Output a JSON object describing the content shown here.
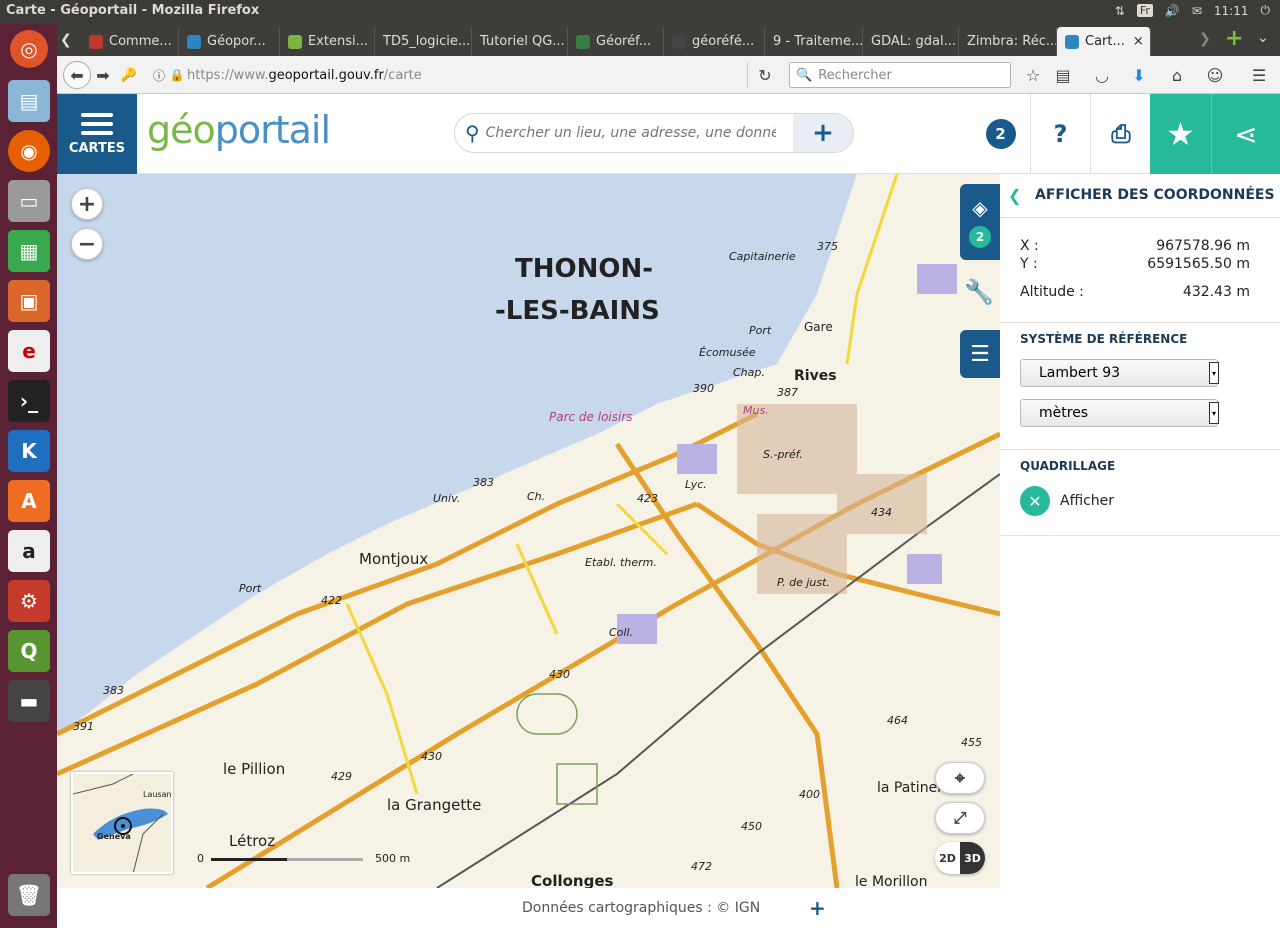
{
  "window": {
    "title": "Carte - Géoportail - Mozilla Firefox",
    "lang": "Fr",
    "time": "11:11"
  },
  "tabs": [
    {
      "label": "Comme...",
      "color": "#c0392b"
    },
    {
      "label": "Géopor...",
      "color": "#2e86c1"
    },
    {
      "label": "Extensi...",
      "color": "#7cb342"
    },
    {
      "label": "TD5_logicie...",
      "color": ""
    },
    {
      "label": "Tutoriel QG...",
      "color": ""
    },
    {
      "label": "Géoréf...",
      "color": "#3a7d44"
    },
    {
      "label": "géoréfé...",
      "color": "#444"
    },
    {
      "label": "9 - Traiteme...",
      "color": ""
    },
    {
      "label": "GDAL: gdal...",
      "color": ""
    },
    {
      "label": "Zimbra: Réc...",
      "color": ""
    },
    {
      "label": "Cart...",
      "color": "#2e86c1"
    }
  ],
  "url": {
    "prefix": "https://www.",
    "domain": "geoportail.gouv.fr",
    "path": "/carte"
  },
  "browser_search": {
    "placeholder": "Rechercher"
  },
  "header": {
    "cartes_label": "CARTES",
    "logo_geo": "géo",
    "logo_portail": "portail",
    "search_placeholder": "Chercher un lieu, une adresse, une donnée",
    "layers_count": "2",
    "help": "?"
  },
  "map": {
    "labels": {
      "city_line1": "THONON-",
      "city_line2": "-LES-BAINS",
      "capitainerie": "Capitainerie",
      "port": "Port",
      "ecomusee": "Écomusée",
      "chap": "Chap.",
      "rives": "Rives",
      "gare": "Gare",
      "parc": "Parc de loisirs",
      "univ": "Univ.",
      "ch": "Ch.",
      "lyc": "Lyc.",
      "spref": "S.-préf.",
      "mus": "Mus.",
      "montjoux": "Montjoux",
      "etabl": "Etabl. therm.",
      "coll": "Coll.",
      "pdejust": "P. de just.",
      "pillion": "le Pillion",
      "grangette": "la Grangette",
      "letroz": "Létroz",
      "collonges": "Collonges",
      "patinerie": "la Patinerie",
      "morillon": "le Morillon",
      "port2": "Port",
      "alt375": "375",
      "alt390": "390",
      "alt387": "387",
      "alt383": "383",
      "alt423": "423",
      "alt434": "434",
      "alt422": "422",
      "alt383b": "383",
      "alt391": "391",
      "alt430": "430",
      "alt430b": "430",
      "alt429": "429",
      "alt464": "464",
      "alt455": "455",
      "alt450": "450",
      "alt472": "472",
      "alt400": "400"
    },
    "layers_badge": "2",
    "overview": {
      "lausanne": "Lausan",
      "geneva": "Geneva"
    },
    "scale": {
      "zero": "0",
      "distance": "500 m"
    },
    "view_2d": "2D",
    "view_3d": "3D"
  },
  "panel": {
    "title": "AFFICHER DES COORDONNÉES",
    "x_label": "X :",
    "x_value": "967578.96 m",
    "y_label": "Y :",
    "y_value": "6591565.50 m",
    "alt_label": "Altitude :",
    "alt_value": "432.43 m",
    "ref_title": "SYSTÈME DE RÉFÉRENCE",
    "ref_value": "Lambert 93",
    "unit_value": "mètres",
    "grid_title": "QUADRILLAGE",
    "grid_label": "Afficher"
  },
  "footer": {
    "credits": "Données cartographiques : ©  IGN"
  },
  "colors": {
    "brand_blue": "#1a5a8b",
    "brand_green": "#26b99a",
    "logo_orange": "#f39200",
    "logo_blue": "#4a90c8"
  }
}
